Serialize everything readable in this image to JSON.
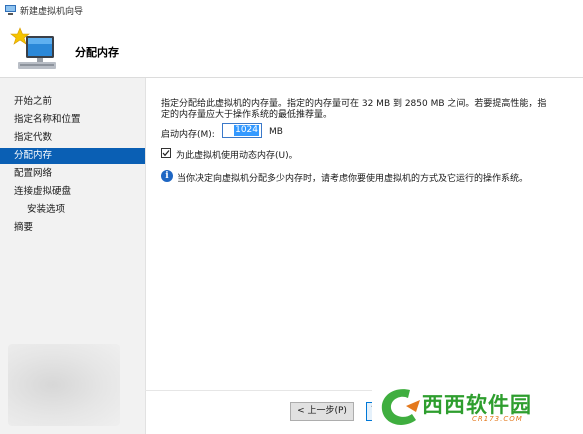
{
  "window": {
    "title": "新建虚拟机向导"
  },
  "header": {
    "title": "分配内存",
    "icon": "computer-with-star-icon"
  },
  "sidebar": {
    "items": [
      {
        "label": "开始之前",
        "active": false
      },
      {
        "label": "指定名称和位置",
        "active": false
      },
      {
        "label": "指定代数",
        "active": false
      },
      {
        "label": "分配内存",
        "active": true
      },
      {
        "label": "配置网络",
        "active": false
      },
      {
        "label": "连接虚拟硬盘",
        "active": false
      },
      {
        "label": "安装选项",
        "active": false
      },
      {
        "label": "摘要",
        "active": false
      }
    ]
  },
  "main": {
    "description_line1": "指定分配给此虚拟机的内存量。指定的内存量可在 32 MB 到 2850 MB 之间。若要提高性能，指",
    "description_line2": "定的内存量应大于操作系统的最低推荐量。",
    "memory_label": "启动内存(M):",
    "memory_value": "1024",
    "memory_unit": "MB",
    "dynamic_memory_label": "为此虚拟机使用动态内存(U)。",
    "dynamic_memory_checked": true,
    "info_text": "当你决定向虚拟机分配多少内存时，请考虑你要使用虚拟机的方式及它运行的操作系统。"
  },
  "footer": {
    "prev_label": "< 上一步(P)",
    "next_label": "下"
  },
  "watermark": {
    "text": "西西软件园",
    "url": "CR173.COM"
  },
  "colors": {
    "selection": "#0a5fb4",
    "sidebar_bg": "#f2f2f2",
    "watermark_green": "#2e9e2e",
    "watermark_orange": "#e4791d"
  }
}
